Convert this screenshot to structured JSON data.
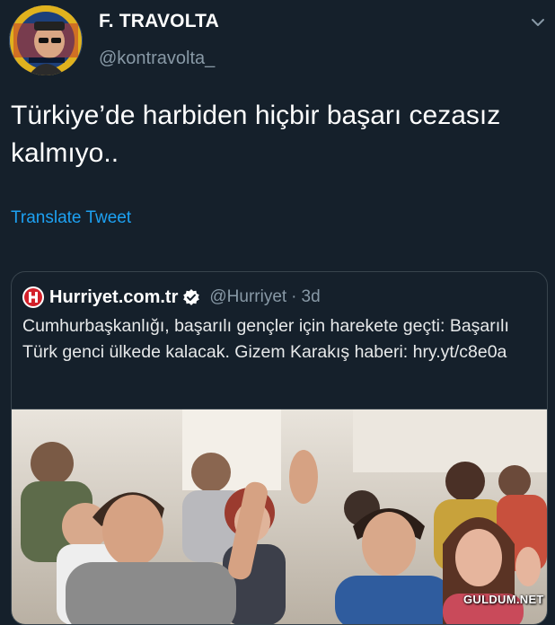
{
  "tweet": {
    "author_name": "F. TRAVOLTA",
    "author_handle": "@kontravolta_",
    "text": "Türkiye’de harbiden hiçbir başarı cezasız kalmıyo..",
    "translate_label": "Translate Tweet"
  },
  "quoted_tweet": {
    "source_name": "Hurriyet.com.tr",
    "source_handle": "@Hurriyet",
    "separator": "·",
    "time": "3d",
    "text": "Cumhurbaşkanlığı, başarılı gençler için harekete geçti: Başarılı Türk genci ülkede kalacak. Gizem Karakış haberi: hry.yt/c8e0a",
    "image_alt": "photo-classroom-students"
  },
  "icons": {
    "menu": "chevron-down-icon",
    "verified": "verified-badge-icon",
    "source_logo": "hurriyet-logo-icon"
  },
  "watermark": "GULDUM.NET",
  "colors": {
    "background": "#15202b",
    "link": "#1da1f2",
    "muted": "#8899a6",
    "border": "#38444d"
  }
}
